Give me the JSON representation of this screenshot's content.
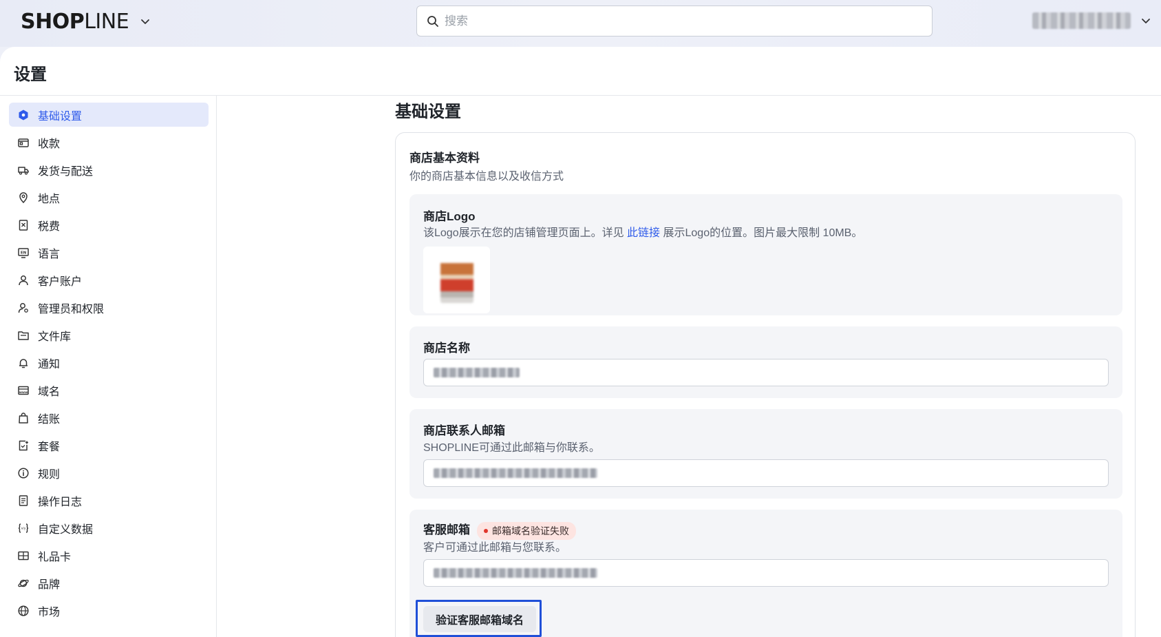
{
  "header": {
    "logo_strong": "SHOP",
    "logo_light": "LINE",
    "search_placeholder": "搜索"
  },
  "page": {
    "title": "设置"
  },
  "sidebar": {
    "items": [
      {
        "label": "基础设置",
        "icon": "settings-hex-icon",
        "active": true
      },
      {
        "label": "收款",
        "icon": "wallet-icon"
      },
      {
        "label": "发货与配送",
        "icon": "truck-icon"
      },
      {
        "label": "地点",
        "icon": "location-pin-icon"
      },
      {
        "label": "税费",
        "icon": "tax-receipt-icon"
      },
      {
        "label": "语言",
        "icon": "language-en-icon"
      },
      {
        "label": "客户账户",
        "icon": "user-icon"
      },
      {
        "label": "管理员和权限",
        "icon": "admin-user-icon"
      },
      {
        "label": "文件库",
        "icon": "folder-icon"
      },
      {
        "label": "通知",
        "icon": "bell-icon"
      },
      {
        "label": "域名",
        "icon": "domain-www-icon"
      },
      {
        "label": "结账",
        "icon": "shopping-bag-icon"
      },
      {
        "label": "套餐",
        "icon": "plan-icon"
      },
      {
        "label": "规则",
        "icon": "info-icon"
      },
      {
        "label": "操作日志",
        "icon": "log-document-icon"
      },
      {
        "label": "自定义数据",
        "icon": "custom-data-braces-icon"
      },
      {
        "label": "礼品卡",
        "icon": "gift-card-icon"
      },
      {
        "label": "品牌",
        "icon": "brand-planet-icon"
      },
      {
        "label": "市场",
        "icon": "globe-icon"
      }
    ]
  },
  "content": {
    "section_title": "基础设置",
    "card": {
      "title": "商店基本资料",
      "subtitle": "你的商店基本信息以及收信方式",
      "logo": {
        "title": "商店Logo",
        "desc_before": "该Logo展示在您的店铺管理页面上。详见 ",
        "desc_link": "此链接",
        "desc_after": " 展示Logo的位置。图片最大限制 10MB。"
      },
      "store_name": {
        "title": "商店名称"
      },
      "contact_email": {
        "title": "商店联系人邮箱",
        "desc": "SHOPLINE可通过此邮箱与你联系。"
      },
      "service_email": {
        "title": "客服邮箱",
        "badge": "邮箱域名验证失败",
        "desc": "客户可通过此邮箱与您联系。",
        "verify_button": "验证客服邮箱域名"
      }
    }
  }
}
